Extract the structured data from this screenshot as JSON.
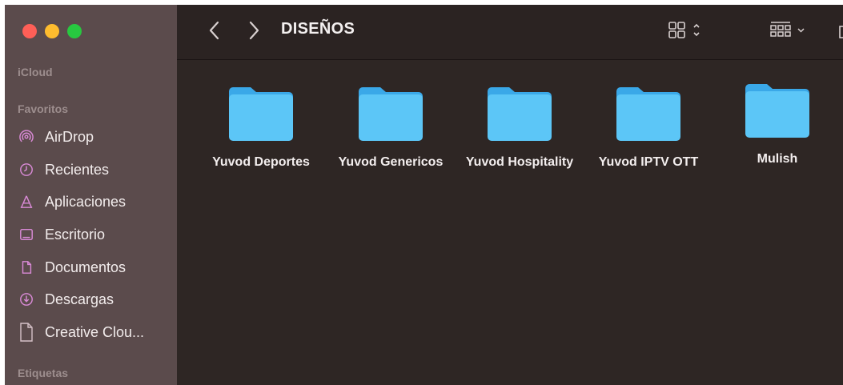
{
  "window": {
    "traffic_lights": [
      "close",
      "minimize",
      "zoom"
    ],
    "colors": {
      "close": "#fe5f57",
      "minimize": "#febc2e",
      "zoom": "#28c840",
      "accent": "#d98ad6",
      "folder": "#5cc6f7"
    }
  },
  "sidebar": {
    "icloud_label": "iCloud",
    "favorites_label": "Favoritos",
    "tags_label": "Etiquetas",
    "items": [
      {
        "label": "AirDrop",
        "icon": "airdrop-icon"
      },
      {
        "label": "Recientes",
        "icon": "clock-icon"
      },
      {
        "label": "Aplicaciones",
        "icon": "applications-icon"
      },
      {
        "label": "Escritorio",
        "icon": "desktop-icon"
      },
      {
        "label": "Documentos",
        "icon": "document-icon"
      },
      {
        "label": "Descargas",
        "icon": "download-icon"
      },
      {
        "label": "Creative Clou...",
        "icon": "file-icon"
      }
    ]
  },
  "toolbar": {
    "title": "DISEÑOS",
    "back_icon": "chevron-left-icon",
    "forward_icon": "chevron-right-icon",
    "view_icon": "grid-view-icon",
    "group_icon": "group-view-icon"
  },
  "files": [
    {
      "name": "Yuvod Deportes"
    },
    {
      "name": "Yuvod Genericos"
    },
    {
      "name": "Yuvod Hospitality"
    },
    {
      "name": "Yuvod IPTV OTT"
    },
    {
      "name": "Mulish"
    }
  ]
}
